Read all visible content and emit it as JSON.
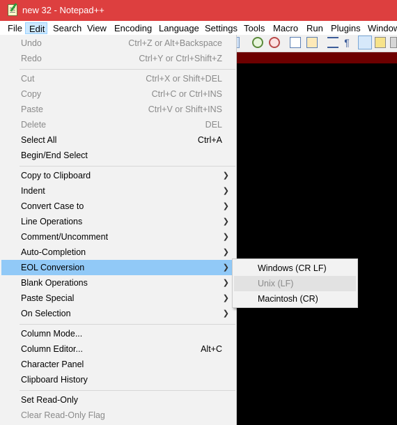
{
  "window": {
    "title": "new 32 - Notepad++"
  },
  "menubar": {
    "items": [
      "File",
      "Edit",
      "Search",
      "View",
      "Encoding",
      "Language",
      "Settings",
      "Tools",
      "Macro",
      "Run",
      "Plugins",
      "Window"
    ]
  },
  "edit_menu": {
    "undo": {
      "label": "Undo",
      "shortcut": "Ctrl+Z or Alt+Backspace"
    },
    "redo": {
      "label": "Redo",
      "shortcut": "Ctrl+Y or Ctrl+Shift+Z"
    },
    "cut": {
      "label": "Cut",
      "shortcut": "Ctrl+X or Shift+DEL"
    },
    "copy": {
      "label": "Copy",
      "shortcut": "Ctrl+C or Ctrl+INS"
    },
    "paste": {
      "label": "Paste",
      "shortcut": "Ctrl+V or Shift+INS"
    },
    "delete": {
      "label": "Delete",
      "shortcut": "DEL"
    },
    "select_all": {
      "label": "Select All",
      "shortcut": "Ctrl+A"
    },
    "begin_end_select": {
      "label": "Begin/End Select"
    },
    "copy_to_clipboard": {
      "label": "Copy to Clipboard"
    },
    "indent": {
      "label": "Indent"
    },
    "convert_case": {
      "label": "Convert Case to"
    },
    "line_operations": {
      "label": "Line Operations"
    },
    "comment": {
      "label": "Comment/Uncomment"
    },
    "auto_completion": {
      "label": "Auto-Completion"
    },
    "eol_conversion": {
      "label": "EOL Conversion"
    },
    "blank_operations": {
      "label": "Blank Operations"
    },
    "paste_special": {
      "label": "Paste Special"
    },
    "on_selection": {
      "label": "On Selection"
    },
    "column_mode": {
      "label": "Column Mode..."
    },
    "column_editor": {
      "label": "Column Editor...",
      "shortcut": "Alt+C"
    },
    "character_panel": {
      "label": "Character Panel"
    },
    "clipboard_history": {
      "label": "Clipboard History"
    },
    "set_read_only": {
      "label": "Set Read-Only"
    },
    "clear_read_only": {
      "label": "Clear Read-Only Flag"
    }
  },
  "eol_submenu": {
    "windows": "Windows (CR LF)",
    "unix": "Unix (LF)",
    "mac": "Macintosh (CR)"
  },
  "colors": {
    "title_bar": "#dd3f3f",
    "menu_highlight": "#91c9f7",
    "tab_strip": "#6d0000",
    "editor_bg": "#000000"
  }
}
